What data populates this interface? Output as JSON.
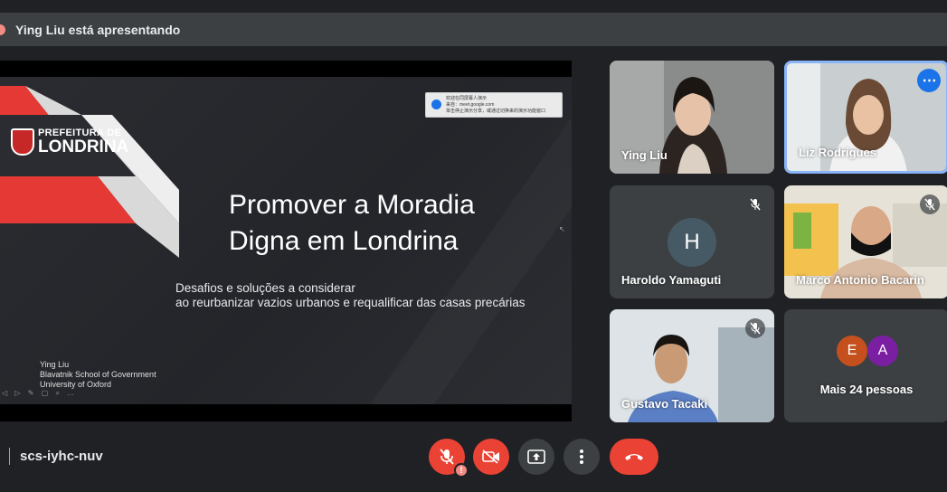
{
  "topbar": {
    "presenting_text": "Ying Liu está apresentando"
  },
  "slide": {
    "logo_line1": "PREFEITURA DE",
    "logo_line2": "LONDRINA",
    "title": "Promover a Moradia\nDigna em Londrina",
    "subtitle": "Desafios e soluções a considerar\nao reurbanizar vazios urbanos e requalificar das casas precárias",
    "author": "Ying Liu\nBlavatnik School of Government\nUniversity of Oxford",
    "notice": "欢迎在同屏幕人演示\n来自：meet.google.com\n单击停止演示分享，或通过切换来的演示功能窗口"
  },
  "participants": [
    {
      "name": "Ying Liu",
      "muted": false
    },
    {
      "name": "Liz Rodrigues",
      "muted": false,
      "selected": true,
      "more_icon": "⋯"
    },
    {
      "name": "Haroldo Yamaguti",
      "muted": true,
      "initial": "H"
    },
    {
      "name": "Marco Antonio Bacarin",
      "muted": true
    },
    {
      "name": "Gustavo Tacaki",
      "muted": true
    },
    {
      "name": "Mais 24 pessoas",
      "avatars": [
        {
          "letter": "E",
          "color": "#c5501e"
        },
        {
          "letter": "A",
          "color": "#7b1fa2"
        }
      ]
    }
  ],
  "bottombar": {
    "meeting_code": "scs-iyhc-nuv",
    "mic_badge": "!"
  },
  "colors": {
    "red": "#ea4335",
    "grey": "#3c4043",
    "accent": "#1a73e8"
  }
}
